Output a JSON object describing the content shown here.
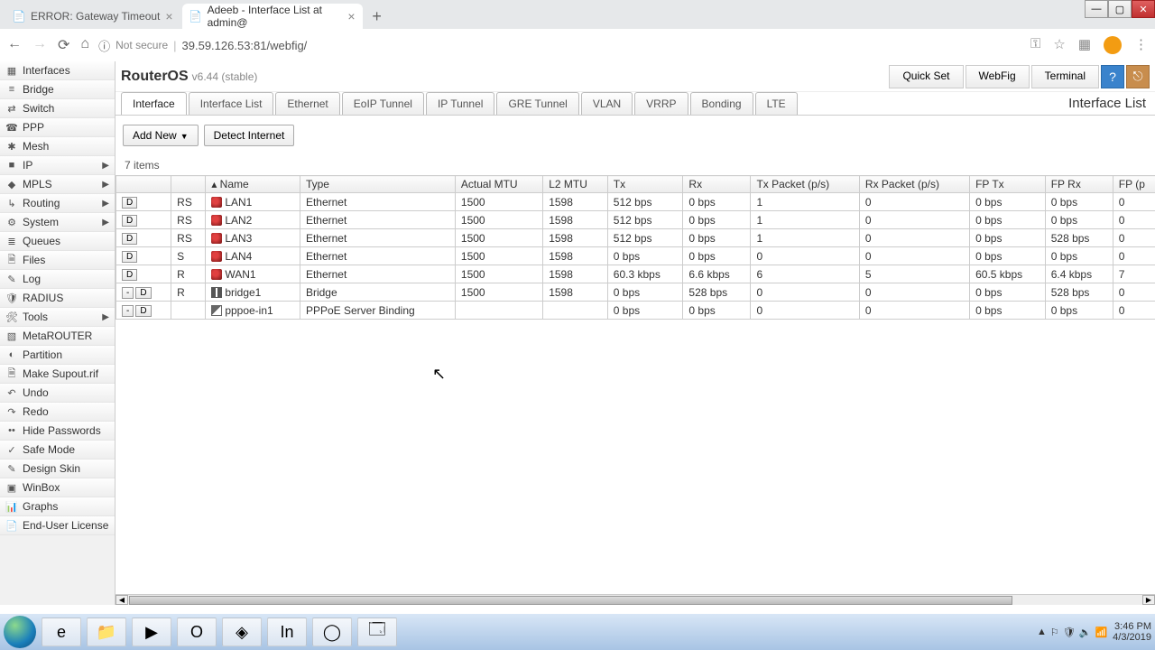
{
  "browser": {
    "tabs": [
      {
        "title": "ERROR: Gateway Timeout",
        "favicon": "📄"
      },
      {
        "title": "Adeeb - Interface List at admin@",
        "favicon": "📄"
      }
    ],
    "addr_secure": "Not secure",
    "addr_url": "39.59.126.53:81/webfig/",
    "back": "←",
    "fwd": "→",
    "reload": "⟳",
    "home": "⌂",
    "info_icon": "ⓘ",
    "key_icon": "⚿",
    "star_icon": "☆",
    "menu_icon": "⋮"
  },
  "window": {
    "min": "—",
    "max": "▢",
    "close": "✕"
  },
  "sidebar": {
    "items": [
      {
        "icon": "▦",
        "label": "Interfaces",
        "sub": false
      },
      {
        "icon": "≡",
        "label": "Bridge",
        "sub": false
      },
      {
        "icon": "⇄",
        "label": "Switch",
        "sub": false
      },
      {
        "icon": "☎",
        "label": "PPP",
        "sub": false
      },
      {
        "icon": "✱",
        "label": "Mesh",
        "sub": false
      },
      {
        "icon": "■",
        "label": "IP",
        "sub": true
      },
      {
        "icon": "◆",
        "label": "MPLS",
        "sub": true
      },
      {
        "icon": "↳",
        "label": "Routing",
        "sub": true
      },
      {
        "icon": "⚙",
        "label": "System",
        "sub": true
      },
      {
        "icon": "≣",
        "label": "Queues",
        "sub": false
      },
      {
        "icon": "🗎",
        "label": "Files",
        "sub": false
      },
      {
        "icon": "✎",
        "label": "Log",
        "sub": false
      },
      {
        "icon": "🛡",
        "label": "RADIUS",
        "sub": false
      },
      {
        "icon": "🛠",
        "label": "Tools",
        "sub": true
      },
      {
        "icon": "▧",
        "label": "MetaROUTER",
        "sub": false
      },
      {
        "icon": "◐",
        "label": "Partition",
        "sub": false
      },
      {
        "icon": "🗎",
        "label": "Make Supout.rif",
        "sub": false
      },
      {
        "icon": "↶",
        "label": "Undo",
        "sub": false
      },
      {
        "icon": "↷",
        "label": "Redo",
        "sub": false
      },
      {
        "icon": "••",
        "label": "Hide Passwords",
        "sub": false
      },
      {
        "icon": "✓",
        "label": "Safe Mode",
        "sub": false
      },
      {
        "icon": "✎",
        "label": "Design Skin",
        "sub": false
      },
      {
        "icon": "▣",
        "label": "WinBox",
        "sub": false
      },
      {
        "icon": "📊",
        "label": "Graphs",
        "sub": false
      },
      {
        "icon": "📄",
        "label": "End-User License",
        "sub": false
      }
    ]
  },
  "header": {
    "logo": "RouterOS",
    "version": "v6.44 (stable)",
    "quickset": "Quick Set",
    "webfig": "WebFig",
    "terminal": "Terminal",
    "help": "?",
    "logout": "⎋"
  },
  "tabs": {
    "items": [
      "Interface",
      "Interface List",
      "Ethernet",
      "EoIP Tunnel",
      "IP Tunnel",
      "GRE Tunnel",
      "VLAN",
      "VRRP",
      "Bonding",
      "LTE"
    ],
    "active_index": 0,
    "page_title": "Interface List"
  },
  "toolbar": {
    "add_new": "Add New",
    "detect": "Detect Internet"
  },
  "table": {
    "count": "7 items",
    "columns": [
      "",
      "",
      "▴ Name",
      "Type",
      "Actual MTU",
      "L2 MTU",
      "Tx",
      "Rx",
      "Tx Packet (p/s)",
      "Rx Packet (p/s)",
      "FP Tx",
      "FP Rx",
      "FP (p"
    ],
    "rows": [
      {
        "btn": [
          "D"
        ],
        "flag": "RS",
        "icon": "eth",
        "name": "LAN1",
        "type": "Ethernet",
        "amtu": "1500",
        "l2": "1598",
        "tx": "512 bps",
        "rx": "0 bps",
        "txp": "1",
        "rxp": "0",
        "fptx": "0 bps",
        "fprx": "0 bps",
        "fpp": "0"
      },
      {
        "btn": [
          "D"
        ],
        "flag": "RS",
        "icon": "eth",
        "name": "LAN2",
        "type": "Ethernet",
        "amtu": "1500",
        "l2": "1598",
        "tx": "512 bps",
        "rx": "0 bps",
        "txp": "1",
        "rxp": "0",
        "fptx": "0 bps",
        "fprx": "0 bps",
        "fpp": "0"
      },
      {
        "btn": [
          "D"
        ],
        "flag": "RS",
        "icon": "eth",
        "name": "LAN3",
        "type": "Ethernet",
        "amtu": "1500",
        "l2": "1598",
        "tx": "512 bps",
        "rx": "0 bps",
        "txp": "1",
        "rxp": "0",
        "fptx": "0 bps",
        "fprx": "528 bps",
        "fpp": "0"
      },
      {
        "btn": [
          "D"
        ],
        "flag": "S",
        "icon": "eth",
        "name": "LAN4",
        "type": "Ethernet",
        "amtu": "1500",
        "l2": "1598",
        "tx": "0 bps",
        "rx": "0 bps",
        "txp": "0",
        "rxp": "0",
        "fptx": "0 bps",
        "fprx": "0 bps",
        "fpp": "0"
      },
      {
        "btn": [
          "D"
        ],
        "flag": "R",
        "icon": "eth",
        "name": "WAN1",
        "type": "Ethernet",
        "amtu": "1500",
        "l2": "1598",
        "tx": "60.3 kbps",
        "rx": "6.6 kbps",
        "txp": "6",
        "rxp": "5",
        "fptx": "60.5 kbps",
        "fprx": "6.4 kbps",
        "fpp": "7"
      },
      {
        "btn": [
          "-",
          "D"
        ],
        "flag": "R",
        "icon": "bridge",
        "name": "bridge1",
        "type": "Bridge",
        "amtu": "1500",
        "l2": "1598",
        "tx": "0 bps",
        "rx": "528 bps",
        "txp": "0",
        "rxp": "0",
        "fptx": "0 bps",
        "fprx": "528 bps",
        "fpp": "0"
      },
      {
        "btn": [
          "-",
          "D"
        ],
        "flag": "",
        "icon": "pppoe",
        "name": "pppoe-in1",
        "type": "PPPoE Server Binding",
        "amtu": "",
        "l2": "",
        "tx": "0 bps",
        "rx": "0 bps",
        "txp": "0",
        "rxp": "0",
        "fptx": "0 bps",
        "fprx": "0 bps",
        "fpp": "0"
      }
    ]
  },
  "taskbar": {
    "icons": [
      "e",
      "📁",
      "▶",
      "O",
      "◈",
      "In",
      "◯",
      "🗔"
    ],
    "tray_icons": [
      "▲",
      "⚐",
      "🛡",
      "🔈",
      "📶"
    ],
    "time": "3:46 PM",
    "date": "4/3/2019"
  }
}
